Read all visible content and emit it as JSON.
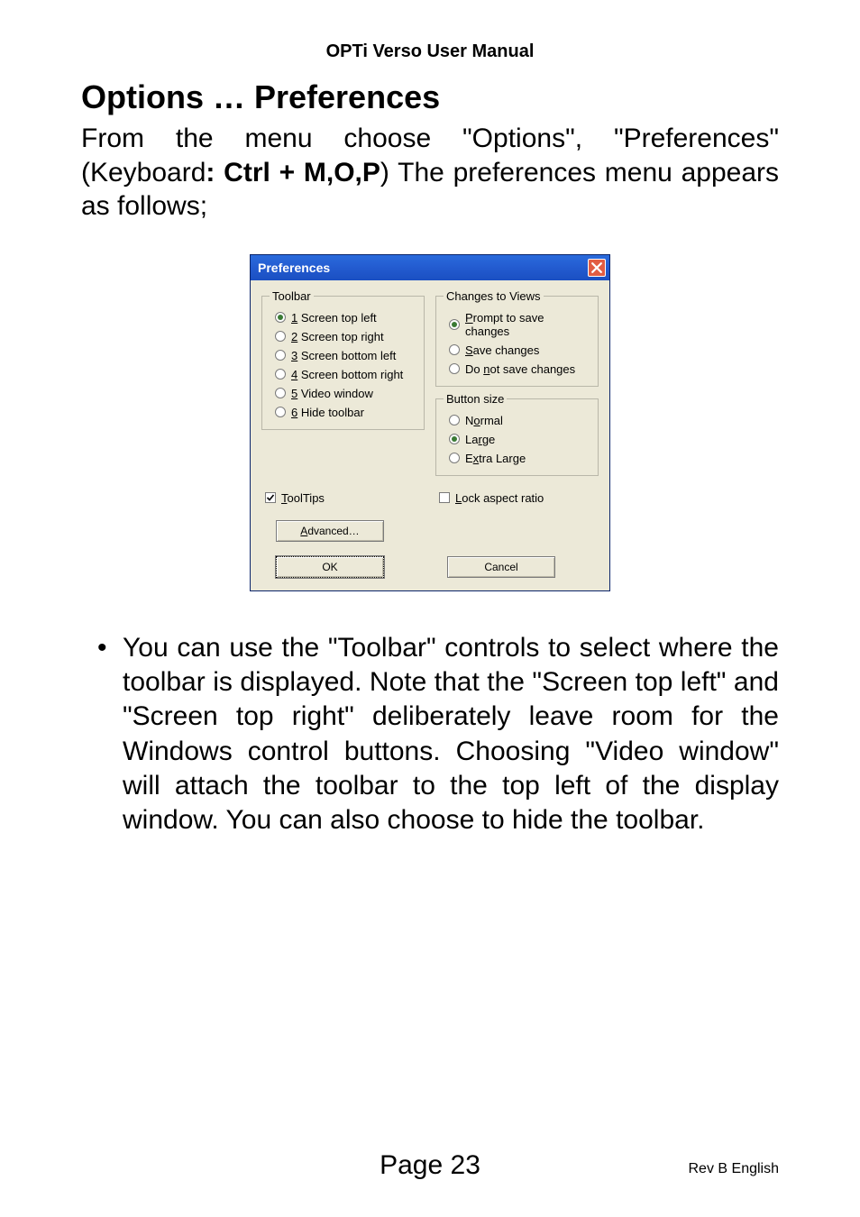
{
  "header": "OPTi Verso User Manual",
  "title": "Options … Preferences",
  "intro_parts": {
    "p1": "From the menu choose \"Options\", \"Preferences\" (Keyboard",
    "p2": ": Ctrl + M,O,P",
    "p3": ") The preferences menu appears as follows;"
  },
  "dialog": {
    "title": "Preferences",
    "toolbar_legend": "Toolbar",
    "toolbar_opts": [
      {
        "pre": "1",
        "rest": " Screen top left",
        "sel": true
      },
      {
        "pre": "2",
        "rest": " Screen top right",
        "sel": false
      },
      {
        "pre": "3",
        "rest": " Screen bottom left",
        "sel": false
      },
      {
        "pre": "4",
        "rest": " Screen bottom right",
        "sel": false
      },
      {
        "pre": "5",
        "rest": " Video window",
        "sel": false
      },
      {
        "pre": "6",
        "rest": " Hide toolbar",
        "sel": false
      }
    ],
    "changes_legend": "Changes to Views",
    "changes_opts": [
      {
        "pre": "P",
        "rest": "rompt to save changes",
        "sel": true
      },
      {
        "pre": "S",
        "rest": "ave changes",
        "sel": false
      },
      {
        "text_before": "Do ",
        "pre": "n",
        "rest": "ot save changes",
        "sel": false
      }
    ],
    "button_size_legend": "Button size",
    "button_size_opts": [
      {
        "text_before": "N",
        "pre": "o",
        "rest": "rmal",
        "sel": false
      },
      {
        "text_before": "La",
        "pre": "r",
        "rest": "ge",
        "sel": true
      },
      {
        "text_before": "E",
        "pre": "x",
        "rest": "tra Large",
        "sel": false
      }
    ],
    "tooltips": {
      "pre": "T",
      "rest": "oolTips",
      "checked": true
    },
    "lock_aspect": {
      "pre": "L",
      "rest": "ock aspect ratio",
      "checked": false
    },
    "advanced_btn": {
      "pre": "A",
      "rest": "dvanced…"
    },
    "ok_btn": "OK",
    "cancel_btn": "Cancel"
  },
  "bullet": "•",
  "bullet_text": "You can use the \"Toolbar\" controls to select where the toolbar is displayed. Note that the \"Screen top left\" and \"Screen top right\" deliberately leave room for the Windows control buttons. Choosing \"Video window\" will attach the toolbar to the top left of the display window. You can also choose to hide the toolbar.",
  "page_number": "Page 23",
  "revision": "Rev B English"
}
